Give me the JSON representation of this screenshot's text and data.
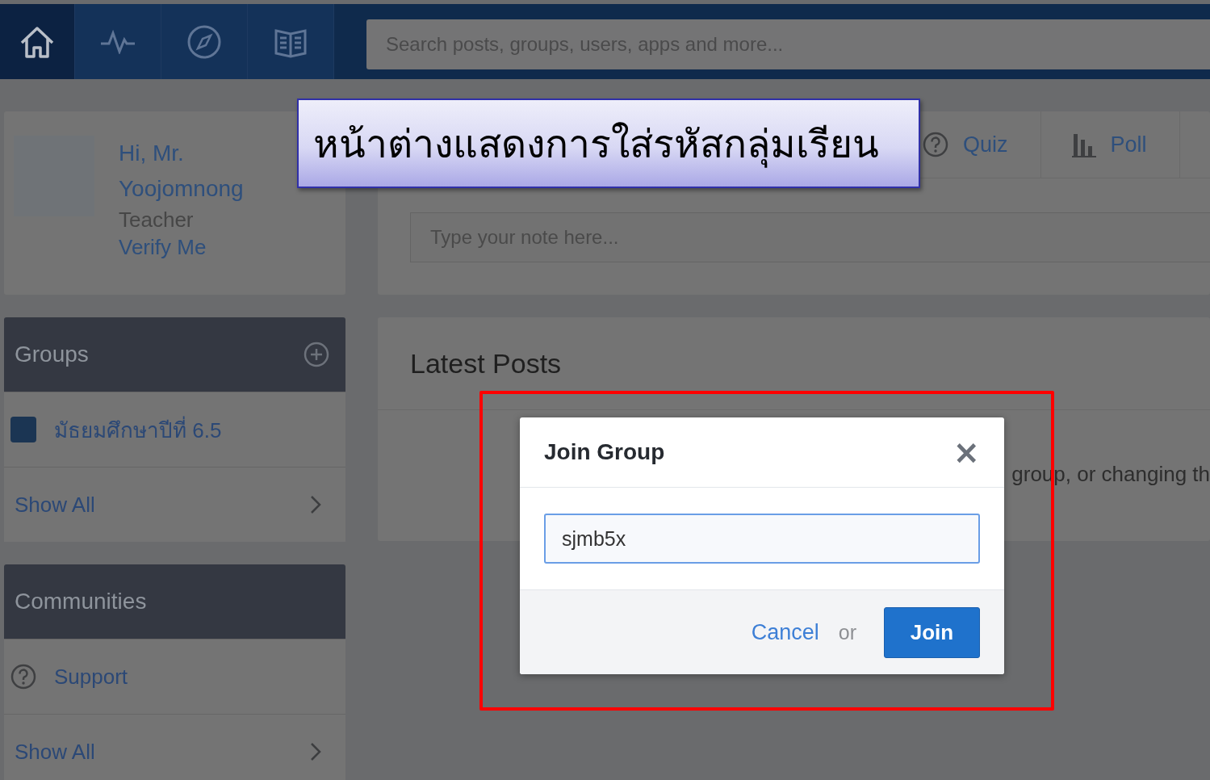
{
  "nav": {
    "items": [
      {
        "kind": "home",
        "selected": true
      },
      {
        "kind": "activity",
        "selected": false
      },
      {
        "kind": "discover",
        "selected": false
      },
      {
        "kind": "library",
        "selected": false
      }
    ],
    "search": {
      "placeholder": "Search posts, groups, users, apps and more..."
    }
  },
  "profile": {
    "greeting": "Hi, Mr. Yoojomnong",
    "role": "Teacher",
    "verify_link": "Verify Me"
  },
  "groups": {
    "title": "Groups",
    "items": [
      {
        "label": "มัธยมศึกษาปีที่ 6.5",
        "color": "#1b3553"
      }
    ],
    "show_all": "Show All"
  },
  "communities": {
    "title": "Communities",
    "items": [
      {
        "label": "Support"
      }
    ],
    "show_all": "Show All"
  },
  "composer": {
    "tabs": [
      {
        "kind": "quiz",
        "label": "Quiz"
      },
      {
        "kind": "poll",
        "label": "Poll"
      }
    ],
    "note": {
      "placeholder": "Type your note here..."
    }
  },
  "latest_posts": {
    "title": "Latest Posts",
    "text": "group, or changing th"
  },
  "dialog": {
    "title": "Join Group",
    "close": "×",
    "input": {
      "value": "sjmb5x"
    },
    "cancel": "Cancel",
    "or": "or",
    "join": "Join"
  },
  "annotation": {
    "text": "หน้าต่างแสดงการใส่รหัสกลุ่มเรียน"
  }
}
